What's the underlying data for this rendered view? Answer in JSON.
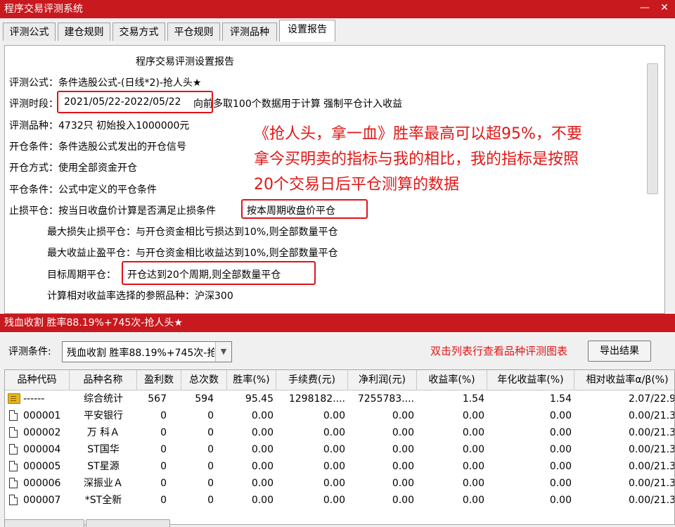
{
  "window": {
    "title": "程序交易评测系统",
    "minimize": "—",
    "close": "✕"
  },
  "tabs": [
    "评测公式",
    "建仓规则",
    "交易方式",
    "平仓规则",
    "评测品种",
    "设置报告"
  ],
  "report": {
    "heading": "程序交易评测设置报告",
    "lines": [
      "评测公式：条件选股公式-(日线*2)-抢人头★",
      "评测时段：",
      "评测品种：4732只 初始投入1000000元",
      "开仓条件：条件选股公式发出的开仓信号",
      "开仓方式：使用全部资金开仓",
      "平仓条件：公式中定义的平仓条件",
      "止损平仓：按当日收盘价计算是否满足止损条件"
    ],
    "period_value": "2021/05/22-2022/05/22",
    "period_suffix": " 向前多取100个数据用于计算 强制平仓计入收益",
    "stop_value": "按本周期收盘价平仓",
    "sub_lines": [
      "最大损失止损平仓：与开仓资金相比亏损达到10%,则全部数量平仓",
      "最大收益止盈平仓：与开仓资金相比收益达到10%,则全部数量平仓"
    ],
    "target_label": "目标周期平仓：",
    "target_value": "开仓达到20个周期,则全部数量平仓",
    "benchmark": "计算相对收益率选择的参照品种：沪深300"
  },
  "annotation": [
    "《抢人头，拿一血》胜率最高可以超95%，不要",
    "拿今买明卖的指标与我的相比，我的指标是按照",
    "20个交易日后平仓测算的数据"
  ],
  "results": {
    "title": "残血收割 胜率88.19%+745次-抢人头★",
    "condition_label": "评测条件:",
    "condition_value": "残血收割 胜率88.19%+745次-抢人头★",
    "hint": "双击列表行查看品种评测图表",
    "export_label": "导出结果",
    "columns": [
      "品种代码",
      "品种名称",
      "盈利数",
      "总次数",
      "胜率(%)",
      "手续费(元)",
      "净利润(元)",
      "收益率(%)",
      "年化收益率(%)",
      "相对收益率α/β(%)"
    ],
    "rows": [
      {
        "icon": "folder-icon",
        "cells": [
          "------",
          "综合统计",
          "567",
          "594",
          "95.45",
          "1298182....",
          "7255783....",
          "1.54",
          "1.54",
          "2.07/22.9"
        ]
      },
      {
        "icon": "document-icon",
        "cells": [
          "000001",
          "平安银行",
          "0",
          "0",
          "0.00",
          "0.00",
          "0.00",
          "0.00",
          "0.00",
          "0.00/21.3"
        ]
      },
      {
        "icon": "document-icon",
        "cells": [
          "000002",
          "万 科Ａ",
          "0",
          "0",
          "0.00",
          "0.00",
          "0.00",
          "0.00",
          "0.00",
          "0.00/21.3"
        ]
      },
      {
        "icon": "document-icon",
        "cells": [
          "000004",
          "ST国华",
          "0",
          "0",
          "0.00",
          "0.00",
          "0.00",
          "0.00",
          "0.00",
          "0.00/21.3"
        ]
      },
      {
        "icon": "document-icon",
        "cells": [
          "000005",
          "ST星源",
          "0",
          "0",
          "0.00",
          "0.00",
          "0.00",
          "0.00",
          "0.00",
          "0.00/21.3"
        ]
      },
      {
        "icon": "document-icon",
        "cells": [
          "000006",
          "深振业Ａ",
          "0",
          "0",
          "0.00",
          "0.00",
          "0.00",
          "0.00",
          "0.00",
          "0.00/21.3"
        ]
      },
      {
        "icon": "document-icon",
        "cells": [
          "000007",
          "*ST全新",
          "0",
          "0",
          "0.00",
          "0.00",
          "0.00",
          "0.00",
          "0.00",
          "0.00/21.3"
        ]
      }
    ]
  },
  "colors": {
    "titlebar": "#c8191e",
    "annotation": "#e21616",
    "highlight_box": "#e0131a"
  }
}
